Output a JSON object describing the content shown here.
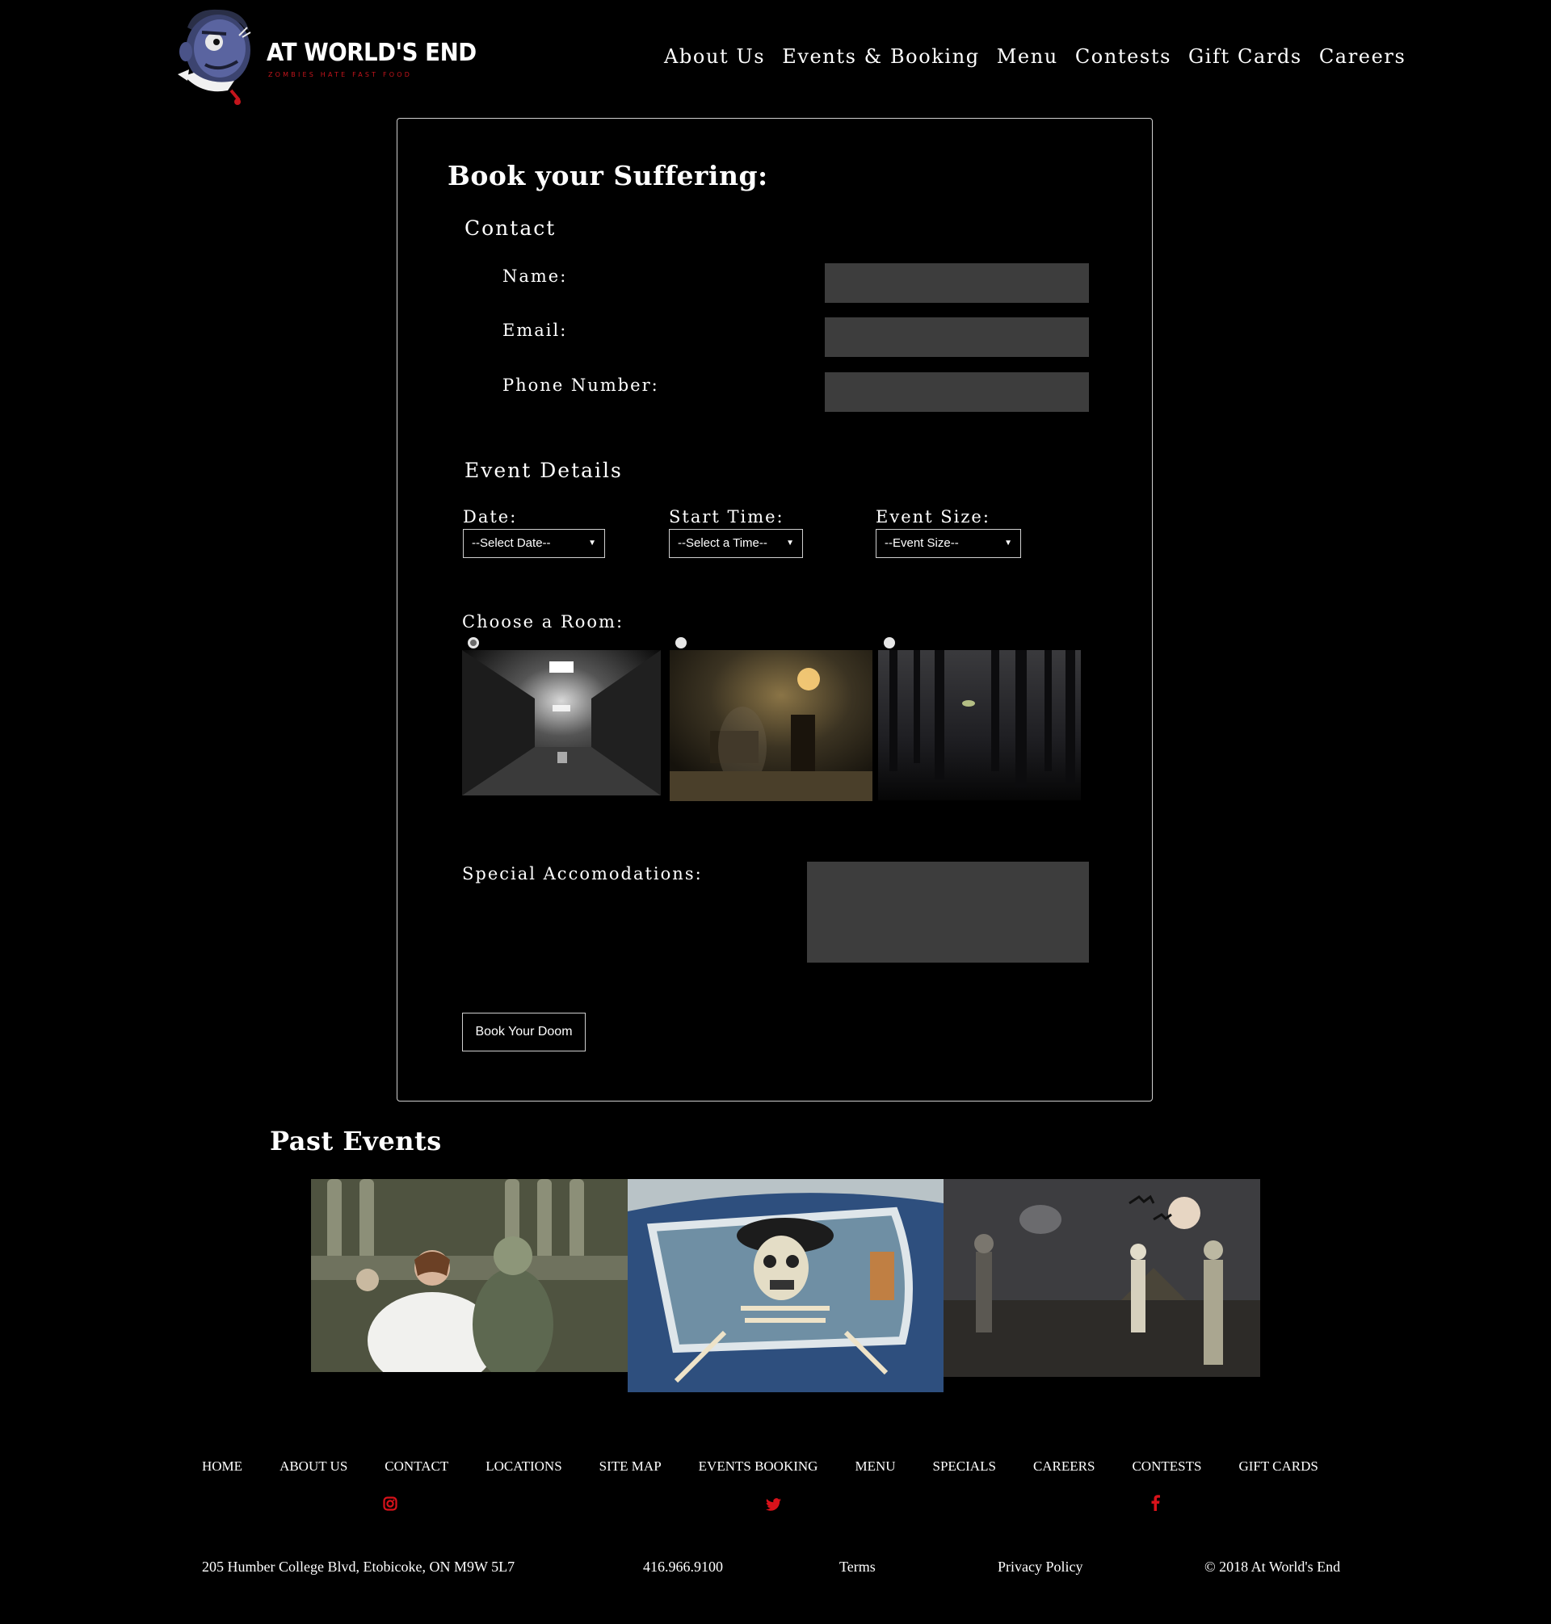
{
  "brand": {
    "name": "AT WORLD'S END",
    "tagline": "ZOMBIES HATE FAST FOOD"
  },
  "nav": [
    "About Us",
    "Events & Booking",
    "Menu",
    "Contests",
    "Gift Cards",
    "Careers"
  ],
  "booking": {
    "title": "Book your Suffering:",
    "contact_heading": "Contact",
    "name_label": "Name:",
    "email_label": "Email:",
    "phone_label": "Phone Number:",
    "name_value": "",
    "email_value": "",
    "phone_value": "",
    "details_heading": "Event Details",
    "date_label": "Date:",
    "date_selected": "--Select Date--",
    "time_label": "Start Time:",
    "time_selected": "--Select a Time--",
    "size_label": "Event Size:",
    "size_selected": "--Event Size--",
    "room_label": "Choose a Room:",
    "special_label": "Special Accomodations:",
    "special_value": "",
    "submit_label": "Book Your Doom"
  },
  "past_events": {
    "title": "Past Events"
  },
  "footer": {
    "links": [
      "HOME",
      "ABOUT US",
      "CONTACT",
      "LOCATIONS",
      "SITE MAP",
      "EVENTS BOOKING",
      "MENU",
      "SPECIALS",
      "CAREERS",
      "CONTESTS",
      "GIFT CARDS"
    ],
    "social": [
      "instagram-icon",
      "twitter-icon",
      "facebook-icon"
    ],
    "address": "205 Humber College Blvd, Etobicoke, ON M9W 5L7",
    "phone": "416.966.9100",
    "terms": "Terms",
    "privacy": "Privacy Policy",
    "copyright": "© 2018 At World's End"
  },
  "colors": {
    "background": "#000000",
    "input_fill": "#3d3d3d",
    "accent_red": "#d8121a"
  }
}
